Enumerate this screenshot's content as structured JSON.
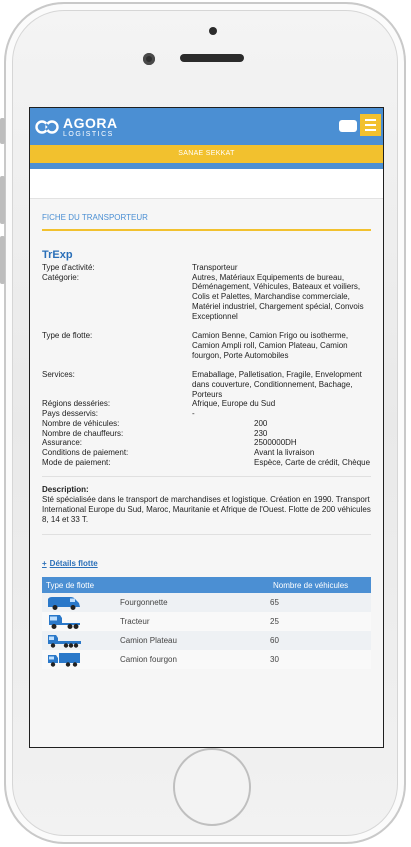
{
  "header": {
    "brand_name": "AGORA",
    "brand_sub": "LOGISTICS",
    "user_name": "SANAE SEKKAT",
    "accent_color": "#4b8fd3",
    "highlight_color": "#f2c12e"
  },
  "page": {
    "section_title": "FICHE DU TRANSPORTEUR",
    "company_name": "TrExp"
  },
  "info": [
    {
      "label": "Type d'activité:",
      "value": "Transporteur"
    },
    {
      "label": "Catégorie:",
      "value": "Autres, Matériaux Equipements de bureau, Déménagement, Véhicules, Bateaux et voiliers, Colis et Palettes, Marchandise commerciale, Matériel industriel, Chargement spécial, Convois Exceptionnel"
    },
    {
      "label": "Type de flotte:",
      "value": "Camion Benne, Camion Frigo ou isotherme, Camion Ampli roll, Camion Plateau, Camion fourgon, Porte Automobiles"
    },
    {
      "label": "Services:",
      "value": "Emaballage, Palletisation, Fragile, Envelopment dans couverture, Conditionnement, Bachage, Porteurs"
    },
    {
      "label": "Régions desséries:",
      "value": "Afrique, Europe du Sud"
    },
    {
      "label": "Pays desservis:",
      "value": "-"
    },
    {
      "label": "Nombre de véhicules:",
      "value": "200"
    },
    {
      "label": "Nombre de chauffeurs:",
      "value": "230"
    },
    {
      "label": "Assurance:",
      "value": "2500000DH"
    },
    {
      "label": "Conditions de paiement:",
      "value": "Avant la livraison"
    },
    {
      "label": "Mode de paiement:",
      "value": "Espèce, Carte de crédit, Chèque"
    }
  ],
  "description": {
    "title": "Description",
    "text": "Sté spécialisée dans le transport de marchandises et logistique. Création en 1990. Transport International Europe du Sud, Maroc, Mauritanie et Afrique de l'Ouest. Flotte de 200 véhicules 8, 14 et 33 T."
  },
  "fleet": {
    "link_label": "Détails flotte",
    "plus_symbol": "+",
    "col_type": "Type de flotte",
    "col_count": "Nombre de véhicules",
    "rows": [
      {
        "icon": "van-icon",
        "name": "Fourgonnette",
        "count": "65"
      },
      {
        "icon": "tractor-truck-icon",
        "name": "Tracteur",
        "count": "25"
      },
      {
        "icon": "flatbed-truck-icon",
        "name": "Camion Plateau",
        "count": "60"
      },
      {
        "icon": "box-truck-icon",
        "name": "Camion fourgon",
        "count": "30"
      }
    ]
  }
}
